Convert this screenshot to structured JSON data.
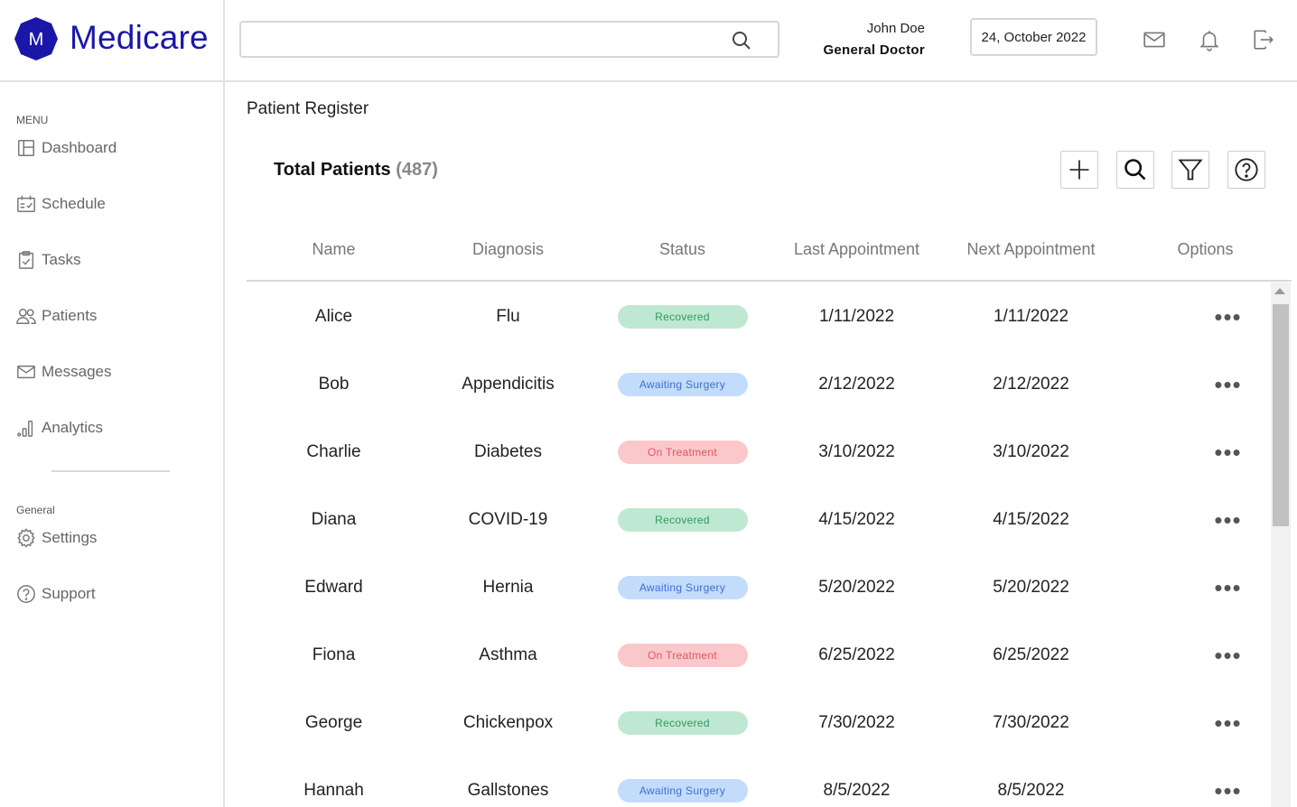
{
  "brand": {
    "logo_letter": "M",
    "name": "Medicare",
    "color": "#1a17a8"
  },
  "sidebar": {
    "menu_label": "MENU",
    "menu_items": [
      {
        "label": "Dashboard",
        "icon": "dashboard-icon"
      },
      {
        "label": "Schedule",
        "icon": "calendar-icon"
      },
      {
        "label": "Tasks",
        "icon": "clipboard-check-icon"
      },
      {
        "label": "Patients",
        "icon": "users-icon"
      },
      {
        "label": "Messages",
        "icon": "envelope-icon"
      },
      {
        "label": "Analytics",
        "icon": "bar-chart-icon"
      }
    ],
    "general_label": "General",
    "general_items": [
      {
        "label": "Settings",
        "icon": "gear-icon"
      },
      {
        "label": "Support",
        "icon": "help-circle-icon"
      }
    ]
  },
  "header": {
    "search": {
      "value": "",
      "placeholder": ""
    },
    "user_name": "John Doe",
    "user_role": "General Doctor",
    "date": "24, October 2022",
    "icons": [
      "mail-icon",
      "bell-icon",
      "logout-icon"
    ]
  },
  "main": {
    "page_title": "Patient Register",
    "total_label": "Total Patients",
    "total_count": "(487)",
    "toolbar_icons": [
      "plus-icon",
      "search-icon",
      "filter-icon",
      "help-icon"
    ],
    "columns": [
      "Name",
      "Diagnosis",
      "Status",
      "Last Appointment",
      "Next Appointment",
      "Options"
    ],
    "rows": [
      {
        "name": "Alice",
        "diagnosis": "Flu",
        "status": "Recovered",
        "last": "1/11/2022",
        "next": "1/11/2022"
      },
      {
        "name": "Bob",
        "diagnosis": "Appendicitis",
        "status": "Awaiting Surgery",
        "last": "2/12/2022",
        "next": "2/12/2022"
      },
      {
        "name": "Charlie",
        "diagnosis": "Diabetes",
        "status": "On Treatment",
        "last": "3/10/2022",
        "next": "3/10/2022"
      },
      {
        "name": "Diana",
        "diagnosis": "COVID-19",
        "status": "Recovered",
        "last": "4/15/2022",
        "next": "4/15/2022"
      },
      {
        "name": "Edward",
        "diagnosis": "Hernia",
        "status": "Awaiting Surgery",
        "last": "5/20/2022",
        "next": "5/20/2022"
      },
      {
        "name": "Fiona",
        "diagnosis": "Asthma",
        "status": "On Treatment",
        "last": "6/25/2022",
        "next": "6/25/2022"
      },
      {
        "name": "George",
        "diagnosis": "Chickenpox",
        "status": "Recovered",
        "last": "7/30/2022",
        "next": "7/30/2022"
      },
      {
        "name": "Hannah",
        "diagnosis": "Gallstones",
        "status": "Awaiting Surgery",
        "last": "8/5/2022",
        "next": "8/5/2022"
      }
    ],
    "options_glyph": "•••",
    "status_colors": {
      "Recovered": {
        "bg": "#bfe8d2",
        "fg": "#2e9a5e"
      },
      "Awaiting Surgery": {
        "bg": "#c3dcfb",
        "fg": "#3b6fd4"
      },
      "On Treatment": {
        "bg": "#fac8cb",
        "fg": "#e05562"
      }
    }
  }
}
